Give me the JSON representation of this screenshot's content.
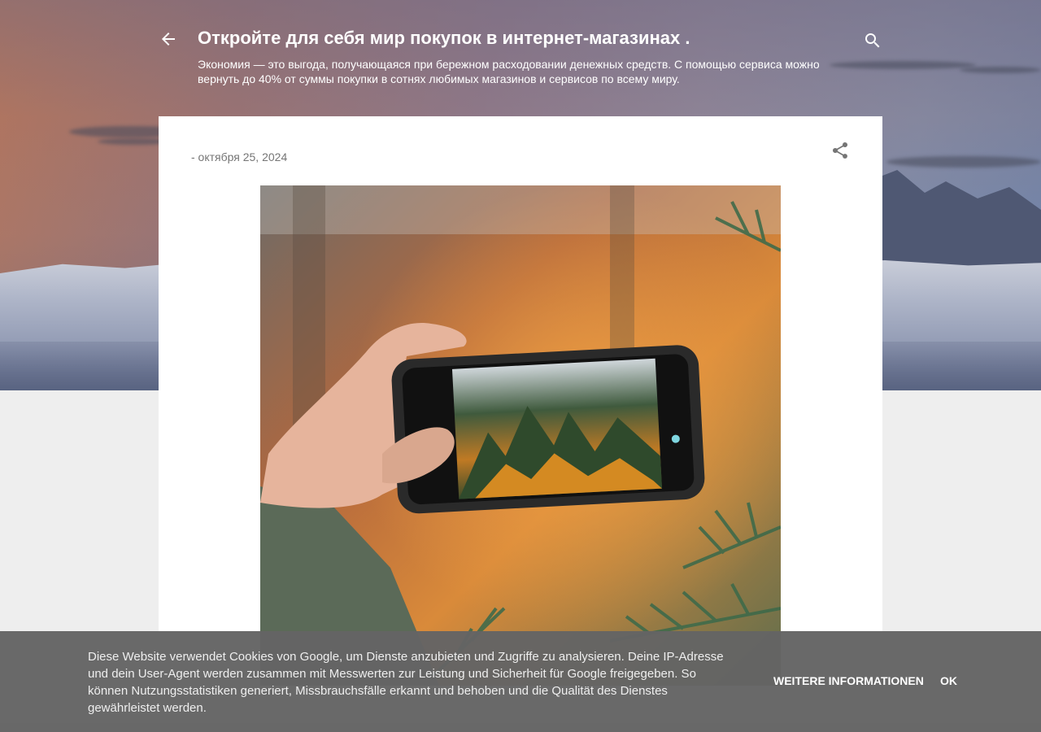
{
  "header": {
    "back_icon": "arrow-back-icon",
    "title": "Откройте для себя мир покупок в интернет-магазинах .",
    "description": "Экономия — это выгода, получающаяся при бережном расходовании денежных средств. С помощью сервиса можно вернуть до 40% от суммы покупки в сотнях любимых магазинов и сервисов по всему миру.",
    "search_icon": "search-icon"
  },
  "post": {
    "date": "- октября 25, 2024",
    "share_icon": "share-icon"
  },
  "cookie_banner": {
    "text": "Diese Website verwendet Cookies von Google, um Dienste anzubieten und Zugriffe zu analysieren. Deine IP-Adresse und dein User-Agent werden zusammen mit Messwerten zur Leistung und Sicherheit für Google freigegeben. So können Nutzungsstatistiken generiert, Missbrauchsfälle erkannt und behoben und die Qualität des Dienstes gewährleistet werden.",
    "more_info_label": "Weitere Informationen",
    "ok_label": "OK"
  },
  "colors": {
    "page_background": "#eeeeee",
    "card_background": "#ffffff",
    "cookie_bar": "#646464",
    "header_text": "#ffffff",
    "date_text": "#757575"
  }
}
